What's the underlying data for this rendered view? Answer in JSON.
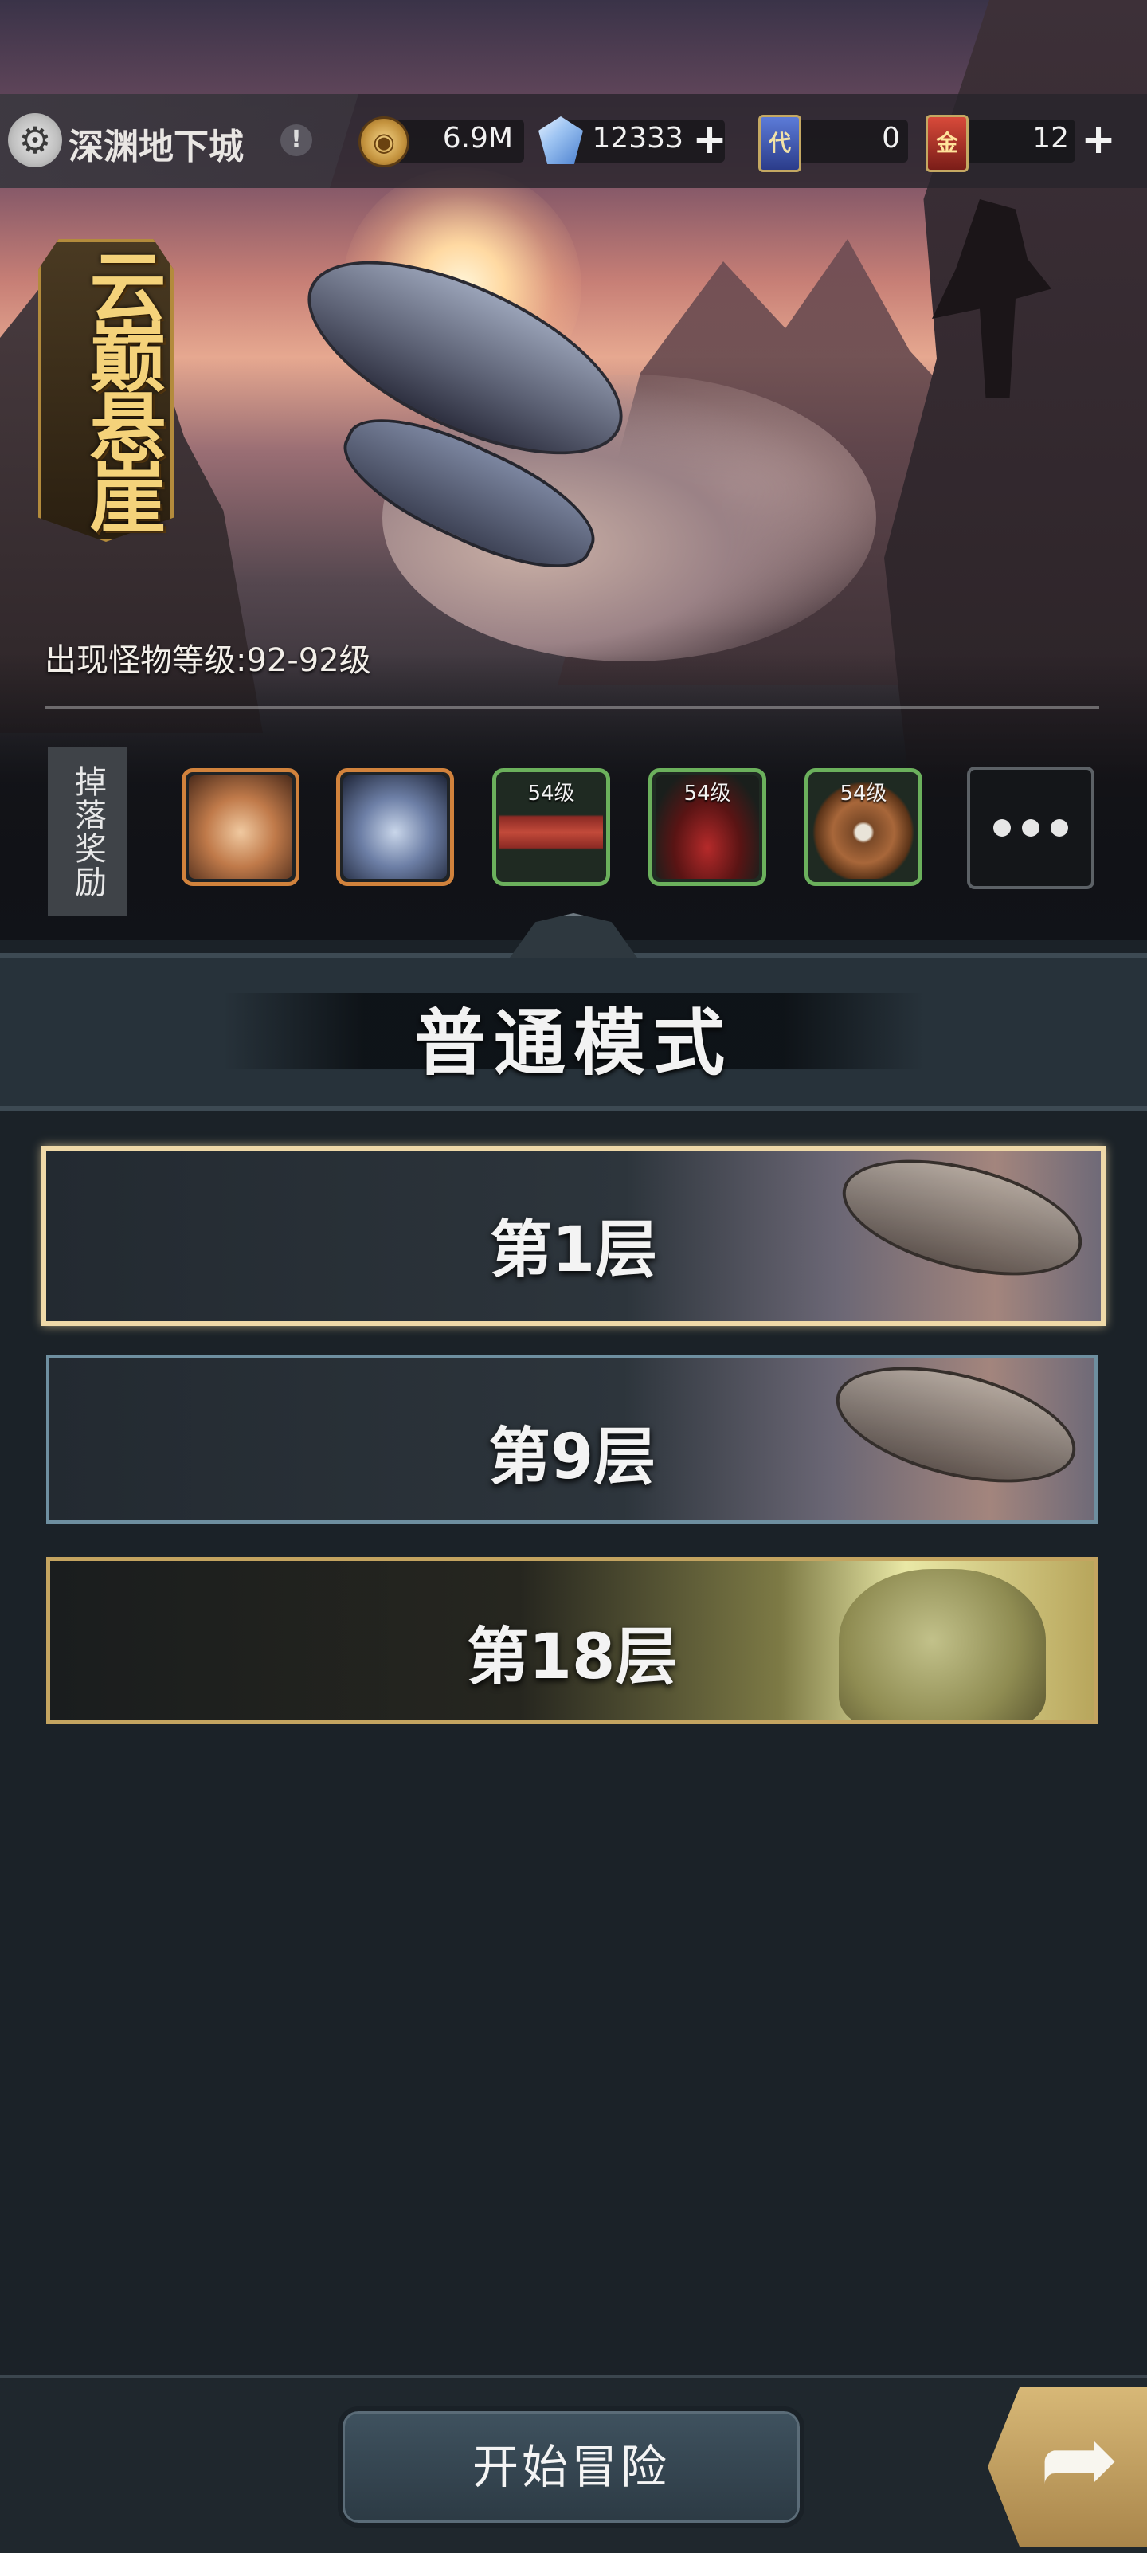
{
  "header": {
    "dungeon_name": "深渊地下城",
    "info_symbol": "!",
    "swirl_symbol": "⚙"
  },
  "resources": {
    "gold": "6.9M",
    "gems": "12333",
    "blue_ticket_label": "代",
    "blue_tickets": "0",
    "red_ticket_label": "金",
    "red_tickets": "12",
    "add_symbol": "+"
  },
  "stage": {
    "title": "云巅悬崖",
    "monster_level": "出现怪物等级:92-92级"
  },
  "drops": {
    "label": "掉落奖励",
    "items": [
      {
        "icon": "deer-portrait-icon",
        "level": ""
      },
      {
        "icon": "wolf-portrait-icon",
        "level": ""
      },
      {
        "icon": "rope-belt-icon",
        "level": "54级"
      },
      {
        "icon": "cloaked-hero-icon",
        "level": "54级"
      },
      {
        "icon": "round-shield-icon",
        "level": "54级"
      }
    ]
  },
  "mode": {
    "title": "普通模式"
  },
  "floors": [
    {
      "label": "第1层",
      "selected": true
    },
    {
      "label": "第9层",
      "selected": false
    },
    {
      "label": "第18层",
      "selected": false
    }
  ],
  "footer": {
    "start_label": "开始冒险",
    "share_symbol": "➦"
  },
  "colors": {
    "accent_gold": "#efd9a8",
    "orange_rarity": "#d1823c",
    "green_rarity": "#6bb05c",
    "panel_dark": "#1b2228"
  }
}
